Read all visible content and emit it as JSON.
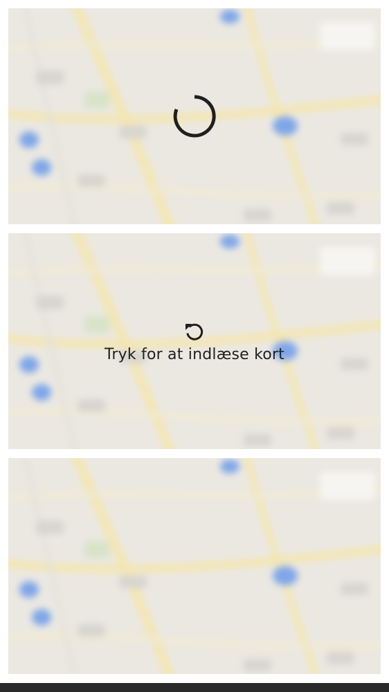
{
  "cards": [
    {
      "state": "loading",
      "icon": "loading-spinner-icon"
    },
    {
      "state": "reload",
      "icon": "reload-icon",
      "reload_label": "Tryk for at indlæse kort"
    },
    {
      "state": "idle"
    }
  ],
  "colors": {
    "map_base": "#ebe8e2",
    "road": "#f3e6b3",
    "marker": "#7fa6e8",
    "spinner": "#1f1f1f",
    "text": "#212121",
    "bottom_bar": "#2a2a2a"
  }
}
